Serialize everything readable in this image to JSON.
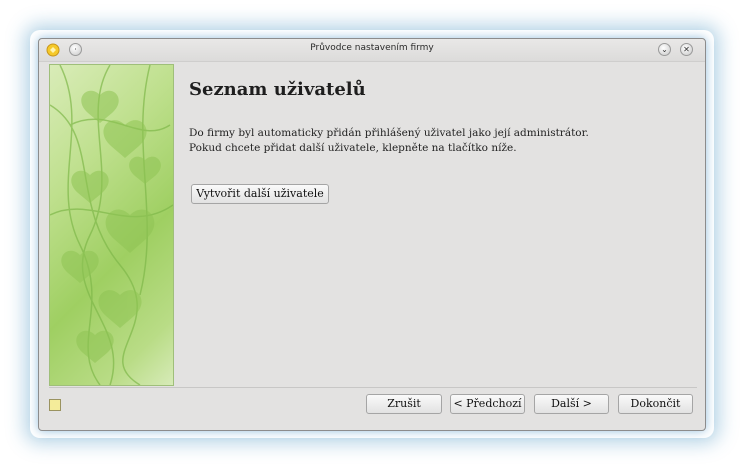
{
  "window": {
    "title": "Průvodce nastavením firmy"
  },
  "page": {
    "title": "Seznam uživatelů",
    "description_line1": "Do firmy byl automaticky přidán přihlášený uživatel jako její administrátor.",
    "description_line2": "Pokud chcete přidat další uživatele, klepněte na tlačítko níže."
  },
  "buttons": {
    "create_user": "Vytvořit další uživatele",
    "cancel": "Zrušit",
    "previous": "< Předchozí",
    "next": "Další >",
    "finish": "Dokončit"
  },
  "icons": {
    "app": "kde-app-icon",
    "minimize": "chevron-down-icon",
    "close": "close-icon",
    "help": "help-icon"
  },
  "colors": {
    "window_bg": "#e3e2e1",
    "sidebar_green": "#9fcf62",
    "glow": "#3c8cbe"
  }
}
